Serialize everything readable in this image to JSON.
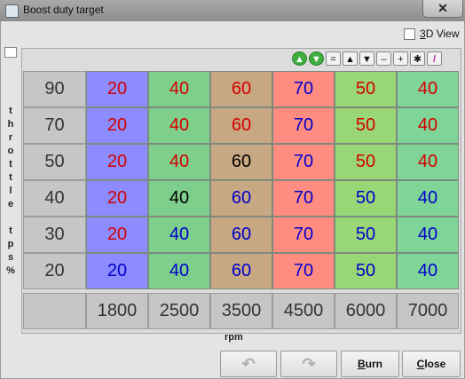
{
  "window": {
    "title": "Boost duty target",
    "close_glyph": "✕"
  },
  "view3d": {
    "label_prefix": "3",
    "label_rest": "D View",
    "checked": false
  },
  "toolbar": {
    "buttons": [
      {
        "name": "increase-icon",
        "glyph": "▲",
        "style": "green"
      },
      {
        "name": "decrease-icon",
        "glyph": "▼",
        "style": "green"
      },
      {
        "name": "equals-icon",
        "glyph": "="
      },
      {
        "name": "up-arrow-icon",
        "glyph": "▲"
      },
      {
        "name": "down-arrow-icon",
        "glyph": "▼"
      },
      {
        "name": "minus-icon",
        "glyph": "–"
      },
      {
        "name": "plus-icon",
        "glyph": "+"
      },
      {
        "name": "multiply-icon",
        "glyph": "✱"
      },
      {
        "name": "brush-icon",
        "glyph": "/",
        "style": "brush"
      }
    ]
  },
  "table": {
    "y_axis_label": [
      "t",
      "h",
      "r",
      "o",
      "t",
      "t",
      "l",
      "e",
      "",
      "t",
      "p",
      "s",
      "%"
    ],
    "x_axis_label": "rpm",
    "y_values": [
      "90",
      "70",
      "50",
      "40",
      "30",
      "20"
    ],
    "x_values": [
      "1800",
      "2500",
      "3500",
      "4500",
      "6000",
      "7000"
    ],
    "column_colors": [
      "#8c8cff",
      "#7fcf8c",
      "#c8a882",
      "#ff8c80",
      "#99d675",
      "#7fd598"
    ],
    "text_colors": {
      "red": "#d40000",
      "blue": "#0000cc",
      "black": "#000000"
    },
    "rows": [
      [
        {
          "v": "20",
          "c": "red"
        },
        {
          "v": "40",
          "c": "red"
        },
        {
          "v": "60",
          "c": "red"
        },
        {
          "v": "70",
          "c": "blue"
        },
        {
          "v": "50",
          "c": "red"
        },
        {
          "v": "40",
          "c": "red"
        }
      ],
      [
        {
          "v": "20",
          "c": "red"
        },
        {
          "v": "40",
          "c": "red"
        },
        {
          "v": "60",
          "c": "red"
        },
        {
          "v": "70",
          "c": "blue"
        },
        {
          "v": "50",
          "c": "red"
        },
        {
          "v": "40",
          "c": "red"
        }
      ],
      [
        {
          "v": "20",
          "c": "red"
        },
        {
          "v": "40",
          "c": "red"
        },
        {
          "v": "60",
          "c": "black"
        },
        {
          "v": "70",
          "c": "blue"
        },
        {
          "v": "50",
          "c": "red"
        },
        {
          "v": "40",
          "c": "red"
        }
      ],
      [
        {
          "v": "20",
          "c": "red"
        },
        {
          "v": "40",
          "c": "black"
        },
        {
          "v": "60",
          "c": "blue"
        },
        {
          "v": "70",
          "c": "blue"
        },
        {
          "v": "50",
          "c": "blue"
        },
        {
          "v": "40",
          "c": "blue"
        }
      ],
      [
        {
          "v": "20",
          "c": "red"
        },
        {
          "v": "40",
          "c": "blue"
        },
        {
          "v": "60",
          "c": "blue"
        },
        {
          "v": "70",
          "c": "blue"
        },
        {
          "v": "50",
          "c": "blue"
        },
        {
          "v": "40",
          "c": "blue"
        }
      ],
      [
        {
          "v": "20",
          "c": "blue"
        },
        {
          "v": "40",
          "c": "blue"
        },
        {
          "v": "60",
          "c": "blue"
        },
        {
          "v": "70",
          "c": "blue"
        },
        {
          "v": "50",
          "c": "blue"
        },
        {
          "v": "40",
          "c": "blue"
        }
      ]
    ]
  },
  "buttons": {
    "undo_glyph": "↶",
    "redo_glyph": "↷",
    "burn_first": "B",
    "burn_rest": "urn",
    "close_first": "C",
    "close_rest": "lose"
  }
}
